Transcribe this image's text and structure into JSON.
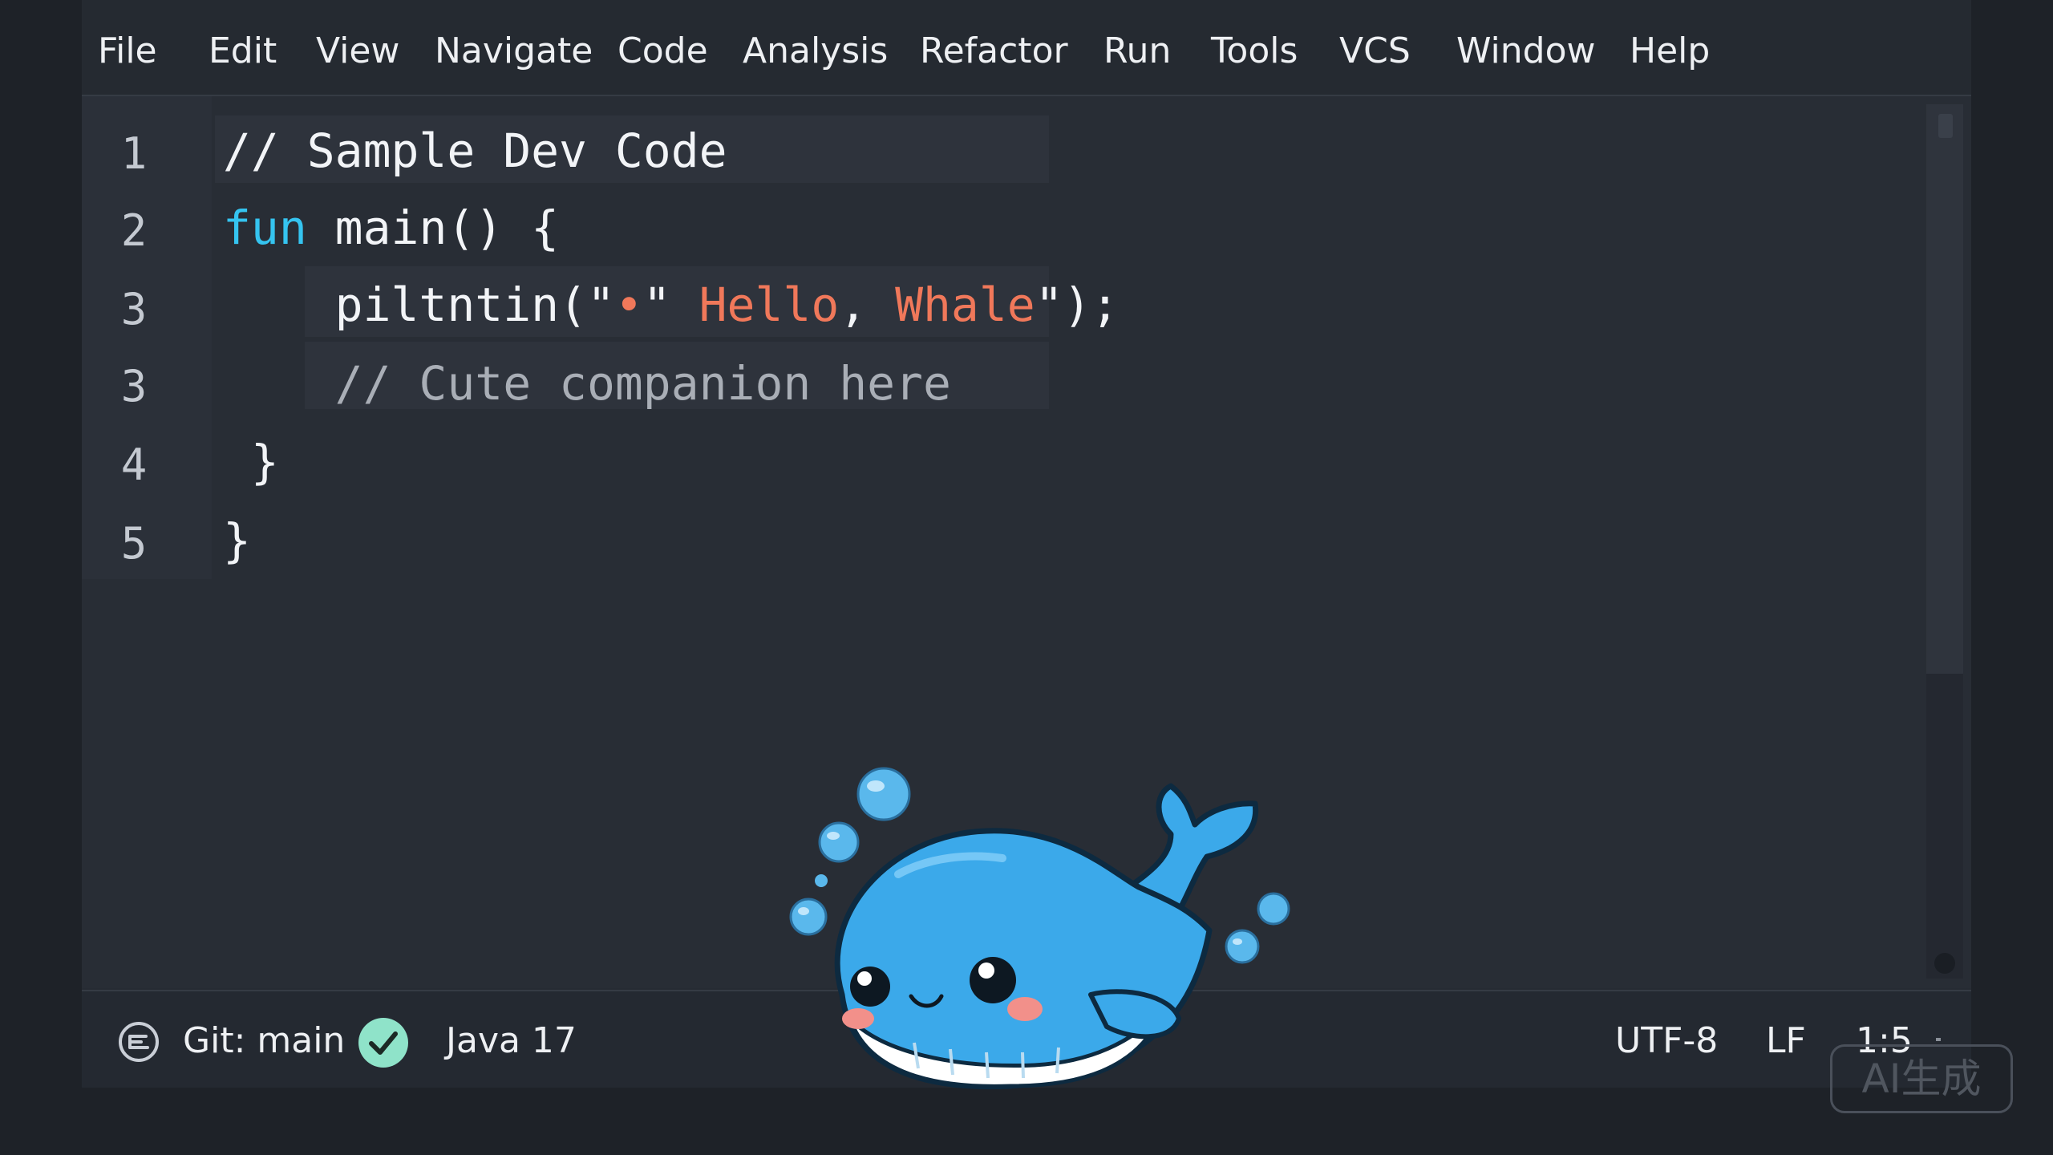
{
  "menu": {
    "items": [
      "File",
      "Edit",
      "View",
      "Navigate",
      "Code",
      "Analysis",
      "Refactor",
      "Run",
      "Tools",
      "VCS",
      "Window",
      "Help"
    ]
  },
  "editor": {
    "gutter": [
      "1",
      "2",
      "3",
      "3",
      "4",
      "5"
    ],
    "lines": [
      [
        {
          "t": "// Sample Dev Code",
          "k": "plain"
        }
      ],
      [
        {
          "t": "fun",
          "k": "keyword"
        },
        {
          "t": " main() {",
          "k": "plain"
        }
      ],
      [
        {
          "t": "    piltntin(\"",
          "k": "plain"
        },
        {
          "t": "•",
          "k": "string"
        },
        {
          "t": "\" ",
          "k": "plain"
        },
        {
          "t": "Hello",
          "k": "string"
        },
        {
          "t": ", ",
          "k": "plain"
        },
        {
          "t": "Whale",
          "k": "string"
        },
        {
          "t": "\");",
          "k": "plain"
        }
      ],
      [
        {
          "t": "    // Cute companion here",
          "k": "comment"
        }
      ],
      [
        {
          "t": " }",
          "k": "plain"
        }
      ],
      [
        {
          "t": "}",
          "k": "plain"
        }
      ]
    ]
  },
  "status": {
    "git": "Git: main",
    "language": "Java 17",
    "encoding": "UTF-8",
    "line_ending": "LF",
    "position": "1:5"
  },
  "watermark": "AI生成",
  "colors": {
    "keyword": "#35c4f0",
    "string": "#f0785a",
    "comment": "#a9aeb6",
    "whale_body": "#3ba9ea",
    "check_badge": "#8fe3c9"
  },
  "icons": {
    "vcs": "git-branch-icon",
    "check": "check-circle-icon",
    "mascot": "whale-mascot-icon"
  }
}
